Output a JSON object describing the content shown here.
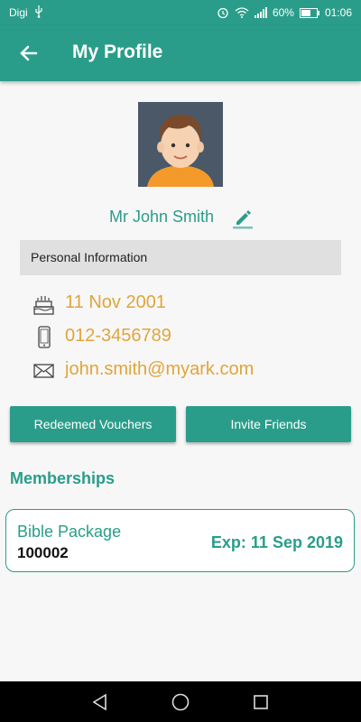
{
  "status_bar": {
    "carrier": "Digi",
    "battery": "60%",
    "time": "01:06"
  },
  "app_bar": {
    "title": "My Profile"
  },
  "profile": {
    "name": "Mr John Smith"
  },
  "personal_info": {
    "heading": "Personal Information",
    "birthday": "11 Nov 2001",
    "phone": "012-3456789",
    "email": "john.smith@myark.com"
  },
  "actions": {
    "redeemed_vouchers": "Redeemed Vouchers",
    "invite_friends": "Invite Friends"
  },
  "memberships": {
    "heading": "Memberships",
    "items": [
      {
        "package": "Bible Package",
        "code": "100002",
        "expiry": "Exp: 11 Sep 2019"
      }
    ]
  },
  "colors": {
    "primary": "#2a9d8a",
    "accent_text": "#e0a53a",
    "section_bg": "#e0e0e0"
  }
}
